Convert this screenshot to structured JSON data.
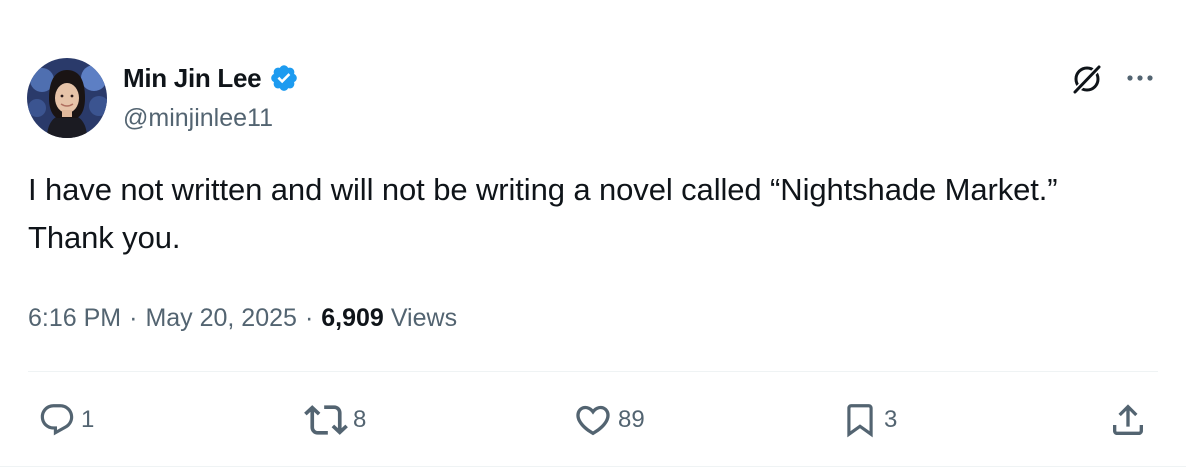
{
  "author": {
    "display_name": "Min Jin Lee",
    "handle": "@minjinlee11",
    "verified": true
  },
  "tweet": {
    "text": "I have not written and will not be writing a novel called “Nightshade Market.” Thank you.",
    "time": "6:16 PM",
    "separator": "·",
    "date": "May 20, 2025",
    "views_count": "6,909",
    "views_label": "Views"
  },
  "actions": {
    "replies": "1",
    "reposts": "8",
    "likes": "89",
    "bookmarks": "3"
  },
  "icons": {
    "header": [
      "grok-icon",
      "more-icon"
    ],
    "actions": [
      "reply-icon",
      "repost-icon",
      "like-icon",
      "bookmark-icon",
      "share-icon"
    ]
  },
  "colors": {
    "text": "#0f1419",
    "secondary": "#536471",
    "verified": "#1d9bf0",
    "divider": "#eff3f4"
  }
}
